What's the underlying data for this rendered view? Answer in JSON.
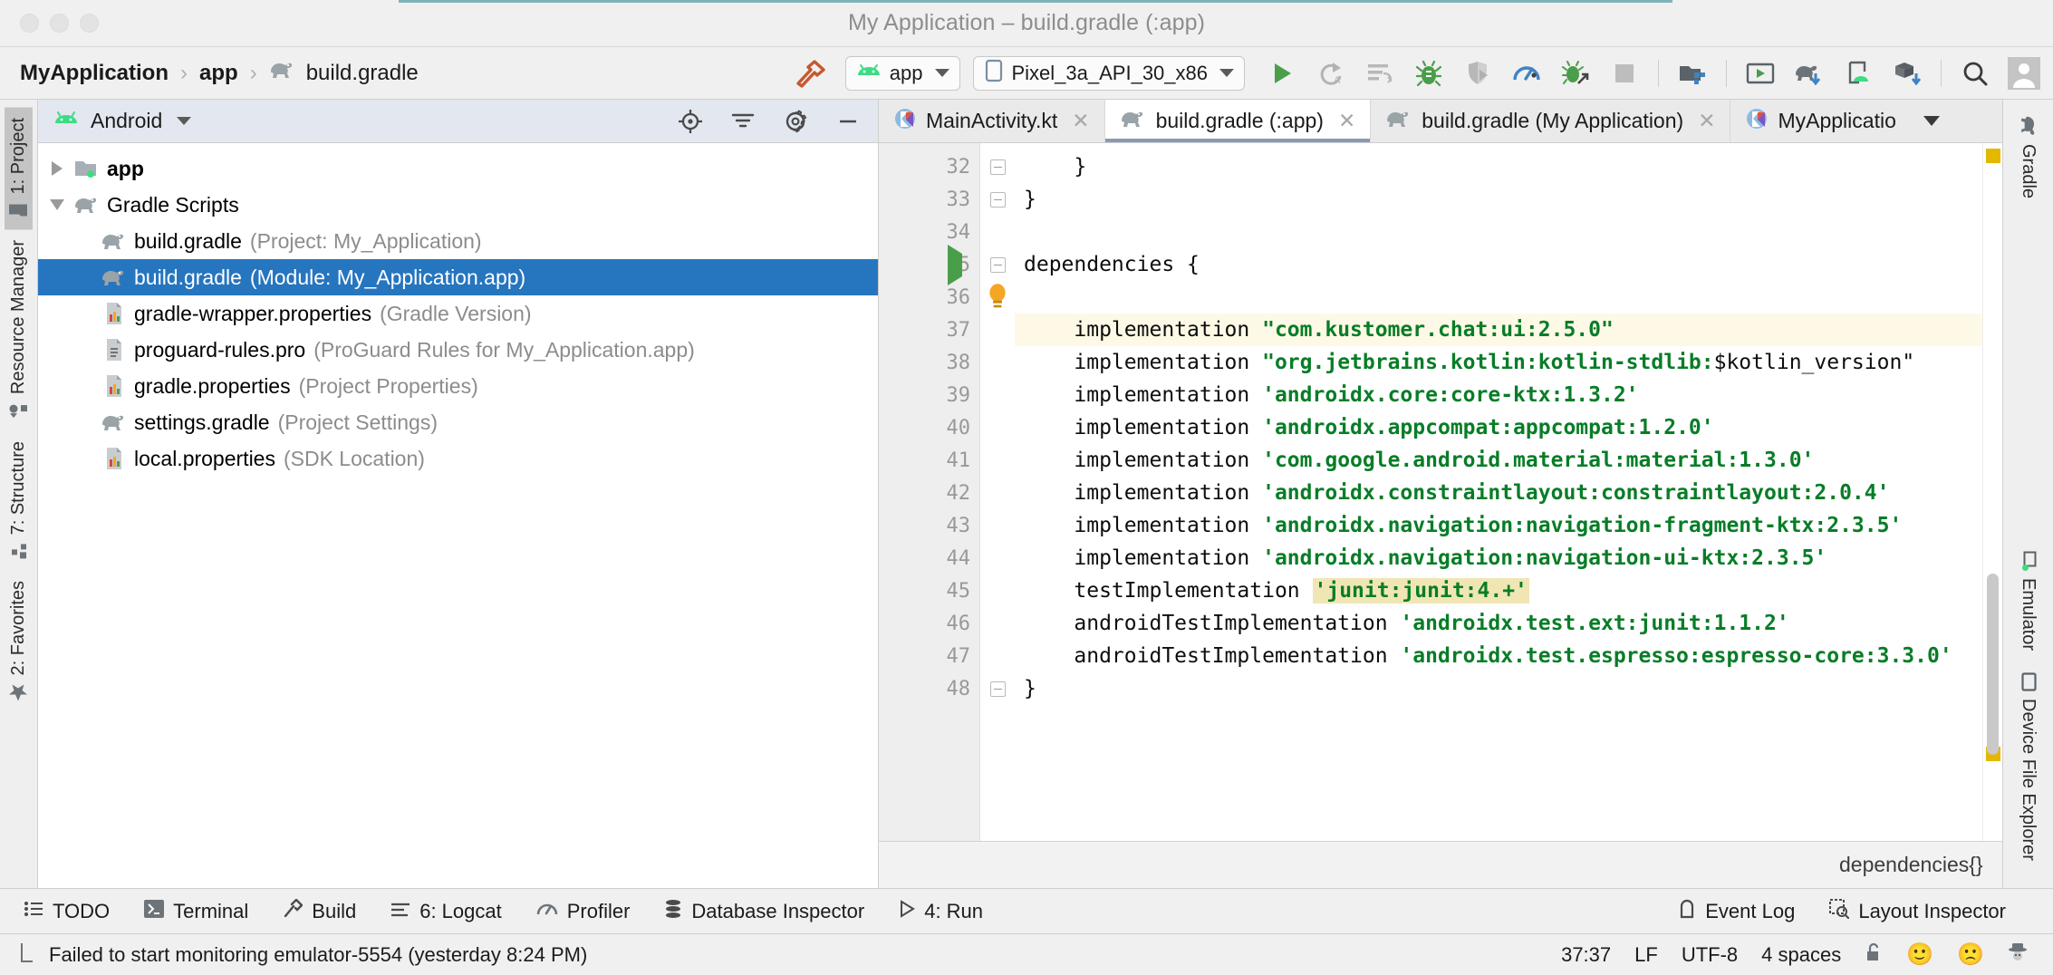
{
  "window": {
    "title": "My Application – build.gradle (:app)",
    "traffic_lights": [
      "close",
      "minimize",
      "zoom"
    ]
  },
  "breadcrumb": {
    "items": [
      {
        "label": "MyApplication",
        "icon": null,
        "bold": true
      },
      {
        "label": "app",
        "icon": null,
        "bold": true
      },
      {
        "label": "build.gradle",
        "icon": "gradle-elephant-icon",
        "bold": false
      }
    ],
    "separator": "›"
  },
  "toolbar": {
    "build_icon": "hammer-icon",
    "module_selector": {
      "label": "app",
      "icon": "android-head-icon"
    },
    "device_selector": {
      "label": "Pixel_3a_API_30_x86",
      "icon": "device-icon"
    },
    "actions": [
      {
        "name": "run-button",
        "icon": "play-icon"
      },
      {
        "name": "apply-changes-button",
        "icon": "apply-changes-icon"
      },
      {
        "name": "apply-code-changes-button",
        "icon": "apply-code-changes-icon"
      },
      {
        "name": "debug-button",
        "icon": "bug-icon"
      },
      {
        "name": "attach-debugger-button",
        "icon": "attach-debugger-icon"
      },
      {
        "name": "profiler-button",
        "icon": "profiler-icon"
      },
      {
        "name": "profile-button",
        "icon": "profile-bug-icon"
      },
      {
        "name": "stop-button",
        "icon": "stop-icon"
      },
      {
        "name": "sdk-manager-button",
        "icon": "sdk-manager-icon"
      },
      {
        "name": "avd-manager-button",
        "icon": "avd-manager-icon"
      },
      {
        "name": "sync-gradle-button",
        "icon": "gradle-sync-icon"
      },
      {
        "name": "layout-inspector-button",
        "icon": "device-android-icon"
      },
      {
        "name": "project-structure-button",
        "icon": "project-structure-icon"
      },
      {
        "name": "search-everywhere-button",
        "icon": "search-icon"
      },
      {
        "name": "account-button",
        "icon": "avatar-icon"
      }
    ]
  },
  "left_rail": {
    "tabs": [
      {
        "label": "1: Project",
        "shortcut": "1",
        "icon": "project-folder-icon",
        "active": true
      },
      {
        "label": "Resource Manager",
        "shortcut": "",
        "icon": "resource-manager-icon",
        "active": false
      },
      {
        "label": "7: Structure",
        "shortcut": "7",
        "icon": "structure-icon",
        "active": false
      },
      {
        "label": "2: Favorites",
        "shortcut": "2",
        "icon": "star-icon",
        "active": false
      }
    ]
  },
  "right_rail": {
    "tabs": [
      {
        "label": "Gradle",
        "icon": "gradle-elephant-icon"
      },
      {
        "label": "Emulator",
        "icon": "emulator-icon"
      },
      {
        "label": "Device File Explorer",
        "icon": "device-file-explorer-icon"
      }
    ]
  },
  "project_panel": {
    "view_selector": {
      "label": "Android",
      "icon": "android-head-icon"
    },
    "header_actions": [
      {
        "name": "select-opened-file-button",
        "icon": "target-icon"
      },
      {
        "name": "collapse-all-button",
        "icon": "collapse-all-icon"
      },
      {
        "name": "settings-button",
        "icon": "gear-icon"
      },
      {
        "name": "hide-button",
        "icon": "minimize-icon"
      }
    ],
    "tree": [
      {
        "name": "app",
        "detail": "",
        "icon": "module-folder-icon",
        "twisty": "collapsed",
        "indent": 1,
        "bold": true,
        "selected": false
      },
      {
        "name": "Gradle Scripts",
        "detail": "",
        "icon": "gradle-elephant-icon",
        "twisty": "expanded",
        "indent": 1,
        "bold": false,
        "selected": false
      },
      {
        "name": "build.gradle",
        "detail": "(Project: My_Application)",
        "icon": "gradle-elephant-icon",
        "twisty": "none",
        "indent": 2,
        "bold": false,
        "selected": false
      },
      {
        "name": "build.gradle",
        "detail": "(Module: My_Application.app)",
        "icon": "gradle-elephant-icon",
        "twisty": "none",
        "indent": 2,
        "bold": false,
        "selected": true
      },
      {
        "name": "gradle-wrapper.properties",
        "detail": "(Gradle Version)",
        "icon": "properties-file-icon",
        "twisty": "none",
        "indent": 2,
        "bold": false,
        "selected": false
      },
      {
        "name": "proguard-rules.pro",
        "detail": "(ProGuard Rules for My_Application.app)",
        "icon": "text-file-icon",
        "twisty": "none",
        "indent": 2,
        "bold": false,
        "selected": false
      },
      {
        "name": "gradle.properties",
        "detail": "(Project Properties)",
        "icon": "properties-file-icon",
        "twisty": "none",
        "indent": 2,
        "bold": false,
        "selected": false
      },
      {
        "name": "settings.gradle",
        "detail": "(Project Settings)",
        "icon": "gradle-elephant-icon",
        "twisty": "none",
        "indent": 2,
        "bold": false,
        "selected": false
      },
      {
        "name": "local.properties",
        "detail": "(SDK Location)",
        "icon": "properties-file-icon",
        "twisty": "none",
        "indent": 2,
        "bold": false,
        "selected": false
      }
    ]
  },
  "editor": {
    "tabs": [
      {
        "label": "MainActivity.kt",
        "icon": "kotlin-file-icon",
        "active": false,
        "closable": true
      },
      {
        "label": "build.gradle (:app)",
        "icon": "gradle-elephant-icon",
        "active": true,
        "closable": true
      },
      {
        "label": "build.gradle (My Application)",
        "icon": "gradle-elephant-icon",
        "active": false,
        "closable": true
      },
      {
        "label": "MyApplicatio",
        "icon": "kotlin-file-icon",
        "active": false,
        "closable": false
      }
    ],
    "overflow_icon": "chevron-down-icon",
    "first_line_number": 32,
    "lines": [
      {
        "n": 32,
        "fold": "end",
        "highlight": false,
        "runmark": false,
        "bulb": false,
        "tokens": [
          {
            "t": "    }",
            "c": "kw"
          }
        ]
      },
      {
        "n": 33,
        "fold": "end",
        "highlight": false,
        "runmark": false,
        "bulb": false,
        "tokens": [
          {
            "t": "}",
            "c": "kw"
          }
        ]
      },
      {
        "n": 34,
        "fold": "none",
        "highlight": false,
        "runmark": false,
        "bulb": false,
        "tokens": [
          {
            "t": "",
            "c": "kw"
          }
        ]
      },
      {
        "n": 35,
        "fold": "start",
        "highlight": false,
        "runmark": true,
        "bulb": false,
        "tokens": [
          {
            "t": "dependencies {",
            "c": "kw"
          }
        ]
      },
      {
        "n": 36,
        "fold": "none",
        "highlight": false,
        "runmark": false,
        "bulb": true,
        "tokens": [
          {
            "t": "",
            "c": "kw"
          }
        ]
      },
      {
        "n": 37,
        "fold": "none",
        "highlight": true,
        "runmark": false,
        "bulb": false,
        "tokens": [
          {
            "t": "    implementation ",
            "c": "kw"
          },
          {
            "t": "\"com.kustomer.chat:ui:2.5.0\"",
            "c": "str"
          }
        ]
      },
      {
        "n": 38,
        "fold": "none",
        "highlight": false,
        "runmark": false,
        "bulb": false,
        "tokens": [
          {
            "t": "    implementation ",
            "c": "kw"
          },
          {
            "t": "\"org.jetbrains.kotlin:kotlin-stdlib:",
            "c": "str"
          },
          {
            "t": "$kotlin_version\"",
            "c": "strv"
          }
        ]
      },
      {
        "n": 39,
        "fold": "none",
        "highlight": false,
        "runmark": false,
        "bulb": false,
        "tokens": [
          {
            "t": "    implementation ",
            "c": "kw"
          },
          {
            "t": "'androidx.core:core-ktx:1.3.2'",
            "c": "str"
          }
        ]
      },
      {
        "n": 40,
        "fold": "none",
        "highlight": false,
        "runmark": false,
        "bulb": false,
        "tokens": [
          {
            "t": "    implementation ",
            "c": "kw"
          },
          {
            "t": "'androidx.appcompat:appcompat:1.2.0'",
            "c": "str"
          }
        ]
      },
      {
        "n": 41,
        "fold": "none",
        "highlight": false,
        "runmark": false,
        "bulb": false,
        "tokens": [
          {
            "t": "    implementation ",
            "c": "kw"
          },
          {
            "t": "'com.google.android.material:material:1.3.0'",
            "c": "str"
          }
        ]
      },
      {
        "n": 42,
        "fold": "none",
        "highlight": false,
        "runmark": false,
        "bulb": false,
        "tokens": [
          {
            "t": "    implementation ",
            "c": "kw"
          },
          {
            "t": "'androidx.constraintlayout:constraintlayout:2.0.4'",
            "c": "str"
          }
        ]
      },
      {
        "n": 43,
        "fold": "none",
        "highlight": false,
        "runmark": false,
        "bulb": false,
        "tokens": [
          {
            "t": "    implementation ",
            "c": "kw"
          },
          {
            "t": "'androidx.navigation:navigation-fragment-ktx:2.3.5'",
            "c": "str"
          }
        ]
      },
      {
        "n": 44,
        "fold": "none",
        "highlight": false,
        "runmark": false,
        "bulb": false,
        "tokens": [
          {
            "t": "    implementation ",
            "c": "kw"
          },
          {
            "t": "'androidx.navigation:navigation-ui-ktx:2.3.5'",
            "c": "str"
          }
        ]
      },
      {
        "n": 45,
        "fold": "none",
        "highlight": false,
        "runmark": false,
        "bulb": false,
        "tokens": [
          {
            "t": "    testImplementation ",
            "c": "kw"
          },
          {
            "t": "'junit:junit:4.+'",
            "c": "str chip"
          }
        ]
      },
      {
        "n": 46,
        "fold": "none",
        "highlight": false,
        "runmark": false,
        "bulb": false,
        "tokens": [
          {
            "t": "    androidTestImplementation ",
            "c": "kw"
          },
          {
            "t": "'androidx.test.ext:junit:1.1.2'",
            "c": "str"
          }
        ]
      },
      {
        "n": 47,
        "fold": "none",
        "highlight": false,
        "runmark": false,
        "bulb": false,
        "tokens": [
          {
            "t": "    androidTestImplementation ",
            "c": "kw"
          },
          {
            "t": "'androidx.test.espresso:espresso-core:3.3.0'",
            "c": "str"
          }
        ]
      },
      {
        "n": 48,
        "fold": "end",
        "highlight": false,
        "runmark": false,
        "bulb": false,
        "tokens": [
          {
            "t": "}",
            "c": "kw"
          }
        ]
      }
    ],
    "breadcrumb_status": "dependencies{}",
    "markers": [
      {
        "color": "#e5b800",
        "top_pct": 1
      },
      {
        "color": "#e5b800",
        "top_pct": 83
      }
    ]
  },
  "bottom_tools": [
    {
      "label": "TODO",
      "icon": "todo-icon"
    },
    {
      "label": "Terminal",
      "icon": "terminal-icon"
    },
    {
      "label": "Build",
      "icon": "build-hammer-icon"
    },
    {
      "label": "6: Logcat",
      "icon": "logcat-icon",
      "shortcut": "6"
    },
    {
      "label": "Profiler",
      "icon": "profiler-icon"
    },
    {
      "label": "Database Inspector",
      "icon": "database-icon"
    },
    {
      "label": "4: Run",
      "icon": "play-icon",
      "shortcut": "4"
    }
  ],
  "bottom_tools_right": [
    {
      "label": "Event Log",
      "icon": "event-log-icon"
    },
    {
      "label": "Layout Inspector",
      "icon": "layout-inspector-icon"
    }
  ],
  "statusbar": {
    "message": "Failed to start monitoring emulator-5554 (yesterday 8:24 PM)",
    "message_icon": "notification-icon",
    "caret_position": "37:37",
    "line_separator": "LF",
    "encoding": "UTF-8",
    "indent": "4 spaces",
    "lock_icon": "unlocked-icon",
    "happy_icon": "🙂",
    "sad_icon": "🙁",
    "hector_icon": "inspector-hat-icon"
  },
  "colors": {
    "accent_selection": "#2675bf",
    "string_green": "#087d27",
    "highlight_line": "#fdf9e6",
    "chip_highlight": "#f0e6b4",
    "android_green": "#3ddc84",
    "marker_yellow": "#e5b800"
  }
}
